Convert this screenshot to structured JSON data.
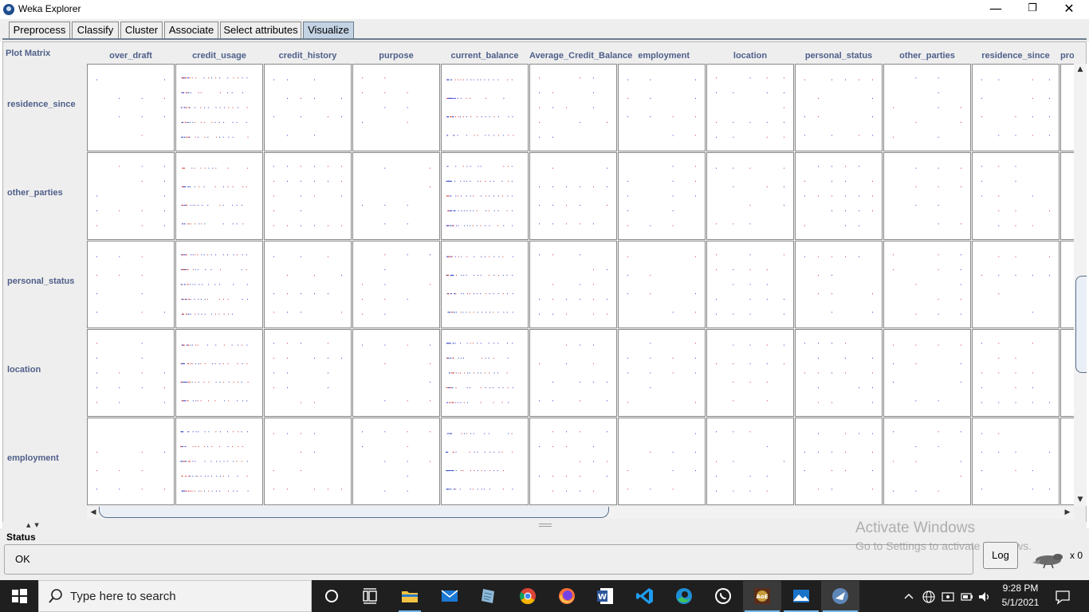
{
  "window": {
    "title": "Weka Explorer",
    "minimize_glyph": "—",
    "restore_glyph": "❐",
    "close_glyph": "✕"
  },
  "tabs": [
    {
      "label": "Preprocess",
      "active": false
    },
    {
      "label": "Classify",
      "active": false
    },
    {
      "label": "Cluster",
      "active": false
    },
    {
      "label": "Associate",
      "active": false
    },
    {
      "label": "Select attributes",
      "active": false
    },
    {
      "label": "Visualize",
      "active": true
    }
  ],
  "plot_matrix": {
    "title": "Plot Matrix",
    "columns": [
      "over_draft",
      "credit_usage",
      "credit_history",
      "purpose",
      "current_balance",
      "Average_Credit_Balance",
      "employment",
      "location",
      "personal_status",
      "other_parties",
      "residence_since",
      "pro"
    ],
    "rows": [
      "residence_since",
      "other_parties",
      "personal_status",
      "location",
      "employment"
    ],
    "colors": {
      "class_good": "#2a3bc9",
      "class_bad": "#d23030",
      "cell_border": "#8a8a8a",
      "label": "#4f5f8a"
    }
  },
  "status": {
    "label": "Status",
    "text": "OK",
    "log_button": "Log",
    "task_count": "x 0"
  },
  "watermark": {
    "title": "Activate Windows",
    "subtitle": "Go to Settings to activate Windows."
  },
  "taskbar": {
    "search_placeholder": "Type here to search",
    "time": "9:28 PM",
    "date": "5/1/2021",
    "apps": [
      "task-view",
      "file-explorer",
      "mail",
      "notepad",
      "chrome",
      "firefox",
      "word",
      "vscode",
      "edge",
      "whatsapp",
      "game",
      "photos",
      "weka"
    ]
  }
}
